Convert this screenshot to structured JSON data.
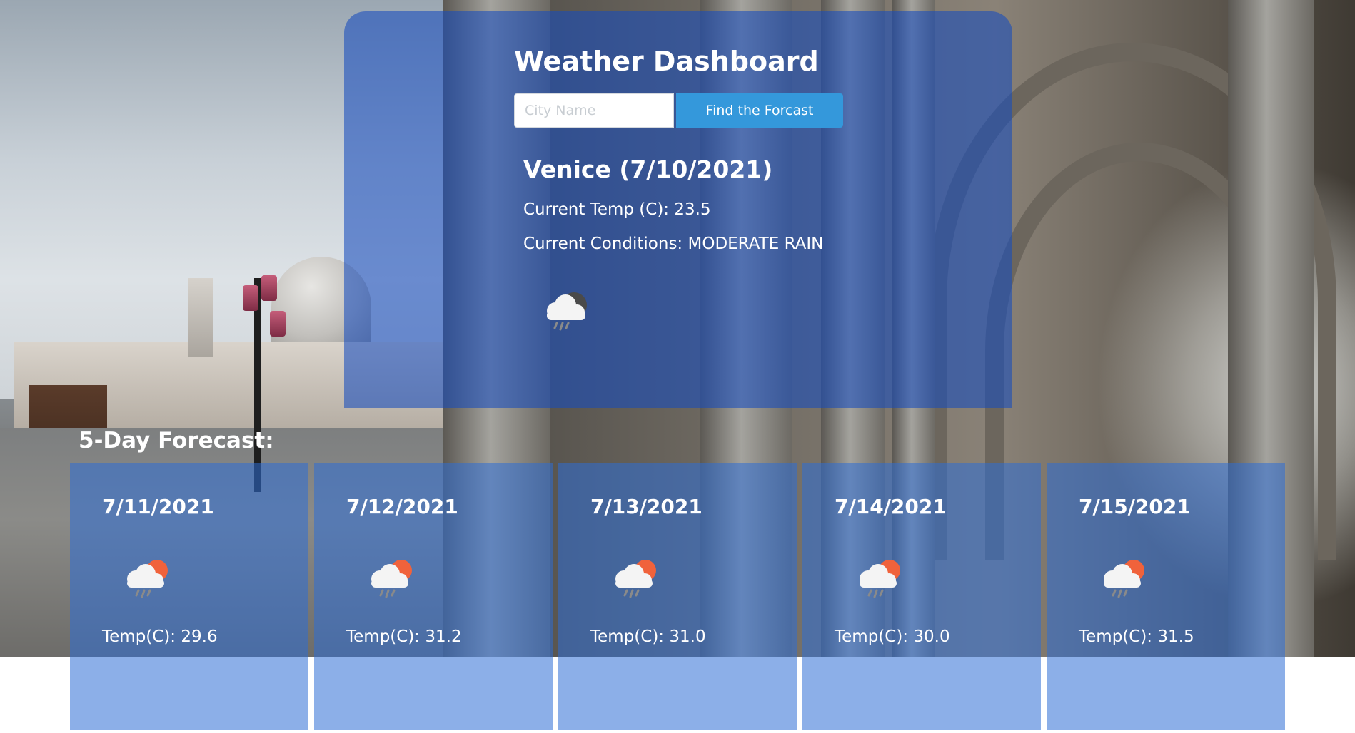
{
  "header": {
    "title": "Weather Dashboard"
  },
  "search": {
    "placeholder": "City Name",
    "value": "",
    "button_label": "Find the Forcast"
  },
  "current": {
    "heading": "Venice (7/10/2021)",
    "temp_text": "Current Temp (C): 23.5",
    "conditions_text": "Current Conditions: MODERATE RAIN",
    "icon": "rain-cloud-night-icon"
  },
  "forecast": {
    "title": "5-Day Forecast:",
    "days": [
      {
        "date": "7/11/2021",
        "temp_text": "Temp(C): 29.6",
        "icon": "sun-cloud-rain-icon"
      },
      {
        "date": "7/12/2021",
        "temp_text": "Temp(C): 31.2",
        "icon": "sun-cloud-rain-icon"
      },
      {
        "date": "7/13/2021",
        "temp_text": "Temp(C): 31.0",
        "icon": "sun-cloud-rain-icon"
      },
      {
        "date": "7/14/2021",
        "temp_text": "Temp(C): 30.0",
        "icon": "sun-cloud-rain-icon"
      },
      {
        "date": "7/15/2021",
        "temp_text": "Temp(C): 31.5",
        "icon": "sun-cloud-rain-icon"
      }
    ]
  },
  "colors": {
    "panel": "#174cbe",
    "button": "#3498db",
    "text": "#ffffff",
    "sun": "#f0623b",
    "cloud": "#f4f4f4",
    "night_cloud": "#4a4a4a",
    "rain": "#8a8a8a"
  }
}
